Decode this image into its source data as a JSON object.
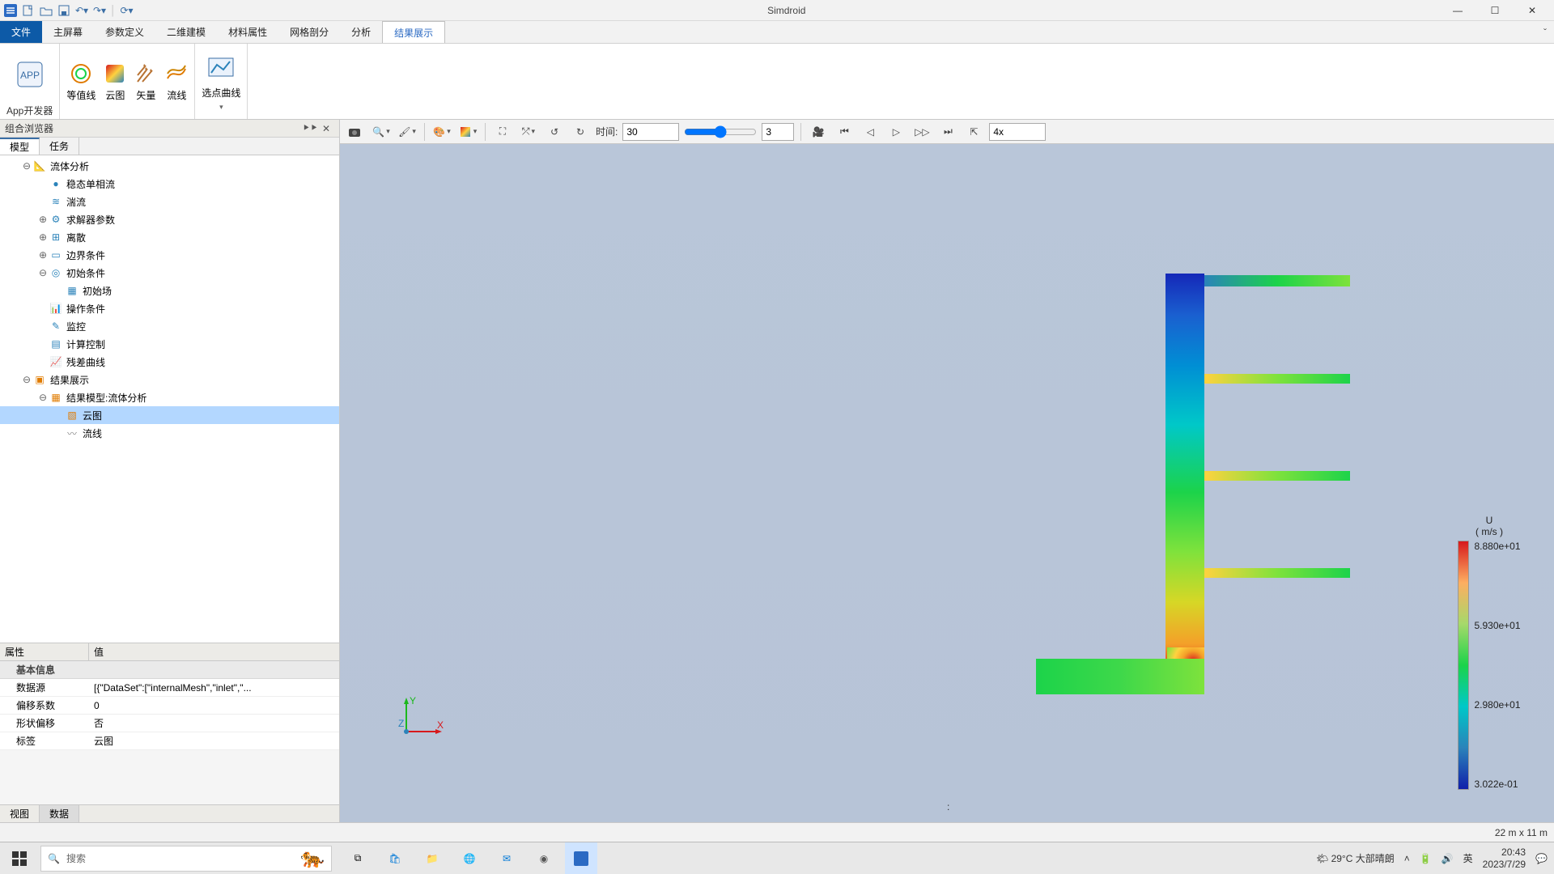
{
  "app": {
    "title": "Simdroid"
  },
  "qat": [
    "logo",
    "new",
    "open",
    "save",
    "undo",
    "redo",
    "refresh"
  ],
  "menu": {
    "file": "文件",
    "tabs": [
      "主屏幕",
      "参数定义",
      "二维建模",
      "材料属性",
      "网格剖分",
      "分析",
      "结果展示"
    ],
    "active_index": 6
  },
  "ribbon": {
    "groups": [
      {
        "label": "App开发器",
        "items": [
          {
            "label": "",
            "icon": "app-icon"
          }
        ]
      },
      {
        "label": "",
        "items": [
          {
            "label": "等值线",
            "icon": "contour-line-icon"
          },
          {
            "label": "云图",
            "icon": "contour-fill-icon"
          },
          {
            "label": "矢量",
            "icon": "vector-icon"
          },
          {
            "label": "流线",
            "icon": "streamline-icon"
          }
        ]
      },
      {
        "label": "",
        "items": [
          {
            "label": "选点曲线",
            "icon": "point-curve-icon"
          }
        ]
      }
    ]
  },
  "browser": {
    "title": "组合浏览器",
    "tabs": [
      "模型",
      "任务"
    ],
    "active_tab": 0,
    "tree": [
      {
        "lvl": 1,
        "exp": "-",
        "icon": "flow-icon",
        "label": "流体分析"
      },
      {
        "lvl": 2,
        "exp": "",
        "icon": "dot-icon",
        "label": "稳态单相流"
      },
      {
        "lvl": 2,
        "exp": "",
        "icon": "turb-icon",
        "label": "湍流"
      },
      {
        "lvl": 2,
        "exp": "+",
        "icon": "solver-icon",
        "label": "求解器参数"
      },
      {
        "lvl": 2,
        "exp": "+",
        "icon": "disc-icon",
        "label": "离散"
      },
      {
        "lvl": 2,
        "exp": "+",
        "icon": "bc-icon",
        "label": "边界条件"
      },
      {
        "lvl": 2,
        "exp": "-",
        "icon": "ic-icon",
        "label": "初始条件"
      },
      {
        "lvl": 3,
        "exp": "",
        "icon": "field-icon",
        "label": "初始场"
      },
      {
        "lvl": 2,
        "exp": "",
        "icon": "op-icon",
        "label": "操作条件"
      },
      {
        "lvl": 2,
        "exp": "",
        "icon": "mon-icon",
        "label": "监控"
      },
      {
        "lvl": 2,
        "exp": "",
        "icon": "ctrl-icon",
        "label": "计算控制"
      },
      {
        "lvl": 2,
        "exp": "",
        "icon": "res-icon",
        "label": "残差曲线"
      },
      {
        "lvl": 1,
        "exp": "-",
        "icon": "results-icon",
        "label": "结果展示"
      },
      {
        "lvl": 2,
        "exp": "-",
        "icon": "model-icon",
        "label": "结果模型:流体分析"
      },
      {
        "lvl": 3,
        "exp": "",
        "icon": "cloud-icon",
        "label": "云图",
        "sel": true
      },
      {
        "lvl": 3,
        "exp": "",
        "icon": "stream-icon",
        "label": "流线"
      }
    ]
  },
  "props": {
    "headers": [
      "属性",
      "值"
    ],
    "section": "基本信息",
    "rows": [
      {
        "k": "数据源",
        "v": "[{\"DataSet\":[\"internalMesh\",\"inlet\",\"..."
      },
      {
        "k": "偏移系数",
        "v": "0"
      },
      {
        "k": "形状偏移",
        "v": "否"
      },
      {
        "k": "标签",
        "v": "云图"
      }
    ],
    "bottom_tabs": [
      "视图",
      "数据"
    ],
    "bottom_active": 1
  },
  "viewtoolbar": {
    "time_label": "时间:",
    "time_value": "30",
    "frame_value": "3",
    "speed": "4x"
  },
  "legend": {
    "var": "U",
    "unit": "( m/s )",
    "ticks": [
      "8.880e+01",
      "5.930e+01",
      "2.980e+01",
      "3.022e-01"
    ]
  },
  "axis": {
    "x": "X",
    "y": "Y",
    "z": "Z"
  },
  "statusbar": {
    "center": ":",
    "dims": "22 m x 11 m"
  },
  "taskbar": {
    "search_placeholder": "搜索",
    "weather": "29°C  大部晴朗",
    "ime": "英",
    "time": "20:43",
    "date": "2023/7/29"
  },
  "chart_data": {
    "type": "heatmap",
    "title": "U",
    "unit": "m/s",
    "ticks": [
      0.3022,
      29.8,
      59.3,
      88.8
    ],
    "range": [
      0.3022,
      88.8
    ],
    "colormap": "rainbow",
    "domain_extent": {
      "width_m": 22,
      "height_m": 11
    }
  }
}
